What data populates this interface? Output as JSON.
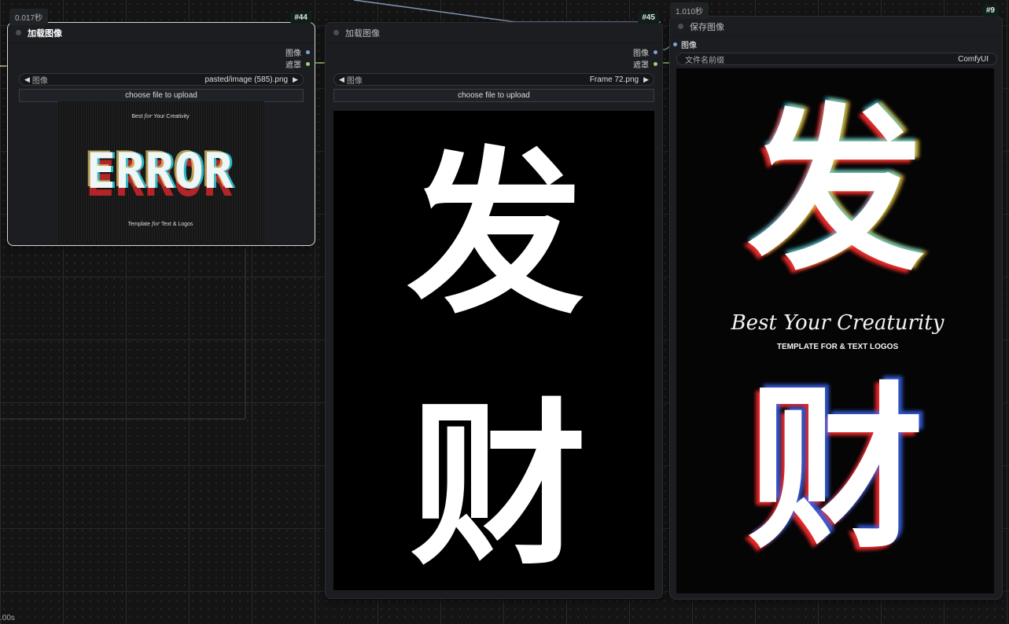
{
  "nodes": {
    "load_a": {
      "id": "#44",
      "time": "0.017秒",
      "title": "加载图像",
      "outputs": {
        "image": "图像",
        "mask": "遮罩"
      },
      "combo": {
        "label": "图像",
        "value": "pasted/image (585).png",
        "prev": "◀",
        "next": "▶"
      },
      "upload_label": "choose file to upload",
      "preview": {
        "top_text": "Best",
        "top_script": "for",
        "top_tail": "Your Creativity",
        "main_text": "ERROR",
        "bottom_text": "Template",
        "bottom_script": "for",
        "bottom_tail": "Text & Logos"
      }
    },
    "load_b": {
      "id": "#45",
      "title": "加载图像",
      "outputs": {
        "image": "图像",
        "mask": "遮罩"
      },
      "combo": {
        "label": "图像",
        "value": "Frame 72.png",
        "prev": "◀",
        "next": "▶"
      },
      "upload_label": "choose file to upload",
      "preview": {
        "char_top": "发",
        "char_bottom": "财"
      }
    },
    "save": {
      "id": "#9",
      "time": "1.010秒",
      "title": "保存图像",
      "input": "图像",
      "prefix": {
        "label": "文件名前缀",
        "value": "ComfyUI"
      },
      "preview": {
        "char_top": "发",
        "char_bottom": "财",
        "script_line": "Best Your Creaturity",
        "caption": "TEMPLATE FOR & TEXT LOGOS"
      }
    }
  },
  "status": {
    "corner_time": ".00s"
  },
  "colors": {
    "image_socket": "#7aa4d6",
    "mask_socket": "#9fcf7a",
    "selected_border": "#d8d8d8"
  }
}
